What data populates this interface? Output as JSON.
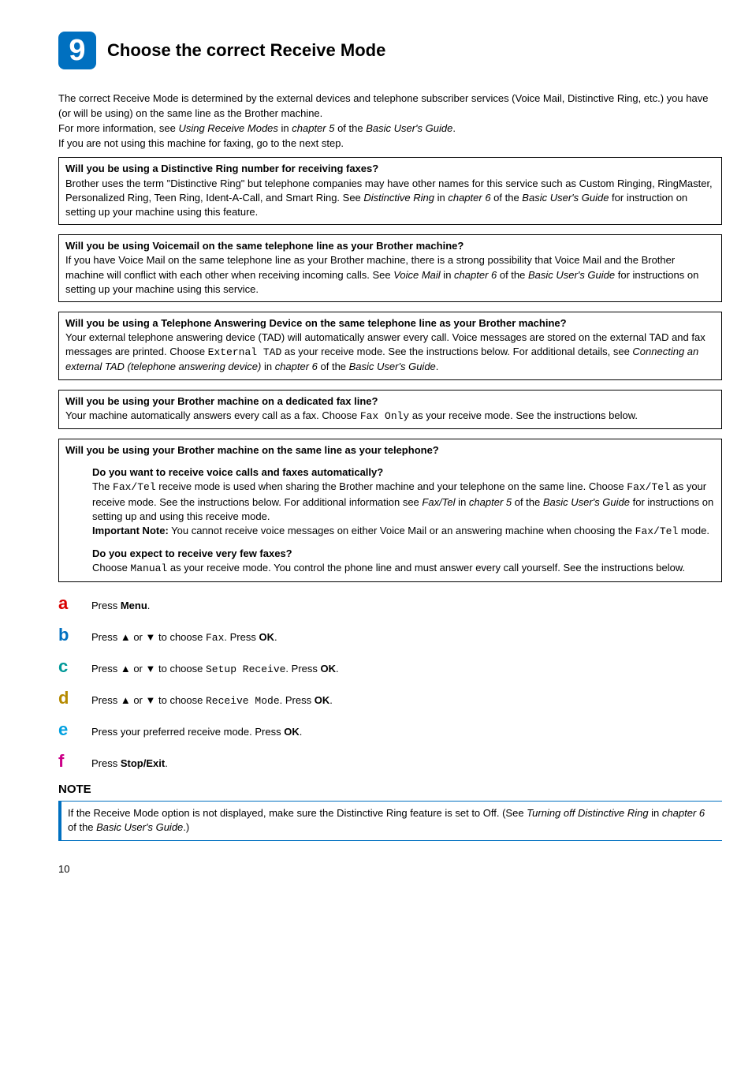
{
  "step_number": "9",
  "title": "Choose the correct Receive Mode",
  "intro": {
    "p1": "The correct Receive Mode is determined by the external devices and telephone subscriber services (Voice Mail, Distinctive Ring, etc.) you have (or will be using) on the same line as the Brother machine.",
    "p2_pre": "For more information, see ",
    "p2_ital1": "Using Receive Modes",
    "p2_mid": " in ",
    "p2_ital2": "chapter 5",
    "p2_mid2": " of the ",
    "p2_ital3": "Basic User's Guide",
    "p2_end": ".",
    "p3": "If you are not using this machine for faxing, go to the next step."
  },
  "box1": {
    "title": "Will you be using a Distinctive Ring number for receiving faxes?",
    "body_pre": "Brother uses the term \"Distinctive Ring\" but telephone companies may have other names for this service such as Custom Ringing, RingMaster, Personalized Ring, Teen Ring, Ident-A-Call, and Smart Ring. See ",
    "ital1": "Distinctive Ring",
    "mid1": " in ",
    "ital2": "chapter 6",
    "mid2": " of the ",
    "ital3": "Basic User's Guide",
    "end": " for instruction on setting up your machine using this feature."
  },
  "box2": {
    "title": "Will you be using Voicemail on the same telephone line as your Brother machine?",
    "body_pre": "If you have Voice Mail on the same telephone line as your Brother machine, there is a strong possibility that Voice Mail and the Brother machine will conflict with each other when receiving incoming calls. See ",
    "ital1": "Voice Mail",
    "mid1": " in ",
    "ital2": "chapter 6",
    "mid2": " of the ",
    "ital3": "Basic User's Guide",
    "end": " for instructions on setting up your machine using this service."
  },
  "box3": {
    "title": "Will you be using a Telephone Answering Device on the same telephone line as your Brother machine?",
    "body_pre": "Your external telephone answering device (TAD) will automatically answer every call. Voice messages are stored on the external TAD and fax messages are printed. Choose ",
    "mono1": "External TAD",
    "body_mid": " as your receive mode. See the instructions below. For additional details, see ",
    "ital1": "Connecting an external TAD (telephone answering device)",
    "mid1": " in ",
    "ital2": "chapter 6",
    "mid2": " of the ",
    "ital3": "Basic User's Guide",
    "end": "."
  },
  "box4": {
    "title": "Will you be using your Brother machine on a dedicated fax line?",
    "body_pre": "Your machine automatically answers every call as a fax. Choose ",
    "mono1": "Fax Only",
    "body_end": " as your receive mode. See the instructions below."
  },
  "box5": {
    "title": "Will you be using your Brother machine on the same line as your telephone?",
    "sub1_title": "Do you want to receive voice calls and faxes automatically?",
    "sub1_pre": "The ",
    "sub1_mono1": "Fax/Tel",
    "sub1_mid1": " receive mode is used when sharing the Brother machine and your telephone on the same line. Choose ",
    "sub1_mono2": "Fax/Tel",
    "sub1_mid2": " as your receive mode. See the instructions below. For additional information see ",
    "sub1_ital1": "Fax/Tel",
    "sub1_mid3": " in ",
    "sub1_ital2": "chapter 5",
    "sub1_mid4": " of the ",
    "sub1_ital3": "Basic User's Guide",
    "sub1_mid5": " for instructions on setting up and using this receive mode.",
    "sub1_note_bold": "Important Note:",
    "sub1_note_pre": " You cannot receive voice messages on either Voice Mail or an answering machine when choosing the ",
    "sub1_note_mono": "Fax/Tel",
    "sub1_note_end": " mode.",
    "sub2_title": "Do you expect to receive very few faxes?",
    "sub2_pre": "Choose ",
    "sub2_mono": "Manual",
    "sub2_end": " as your receive mode. You control the phone line and must answer every call yourself. See the instructions below."
  },
  "steps": {
    "a": {
      "letter": "a",
      "pre": "Press ",
      "bold": "Menu",
      "end": "."
    },
    "b": {
      "letter": "b",
      "pre": "Press ",
      "arrow1": "▲",
      "or": " or ",
      "arrow2": "▼",
      "mid": " to choose ",
      "mono": "Fax",
      "dot": ". Press ",
      "bold": "OK",
      "end": "."
    },
    "c": {
      "letter": "c",
      "pre": "Press ",
      "arrow1": "▲",
      "or": " or ",
      "arrow2": "▼",
      "mid": " to choose ",
      "mono": "Setup Receive",
      "dot": ". Press ",
      "bold": "OK",
      "end": "."
    },
    "d": {
      "letter": "d",
      "pre": "Press ",
      "arrow1": "▲",
      "or": " or ",
      "arrow2": "▼",
      "mid": " to choose ",
      "mono": "Receive Mode",
      "dot": ". Press ",
      "bold": "OK",
      "end": "."
    },
    "e": {
      "letter": "e",
      "pre": "Press your preferred receive mode. Press ",
      "bold": "OK",
      "end": "."
    },
    "f": {
      "letter": "f",
      "pre": "Press ",
      "bold": "Stop/Exit",
      "end": "."
    }
  },
  "note": {
    "heading": "NOTE",
    "pre": "If the Receive Mode option is not displayed, make sure the Distinctive Ring feature is set to Off. (See ",
    "ital1": "Turning off Distinctive Ring",
    "mid1": " in ",
    "ital2": "chapter 6",
    "mid2": " of the ",
    "ital3": "Basic User's Guide",
    "end": ".)"
  },
  "page_number": "10"
}
